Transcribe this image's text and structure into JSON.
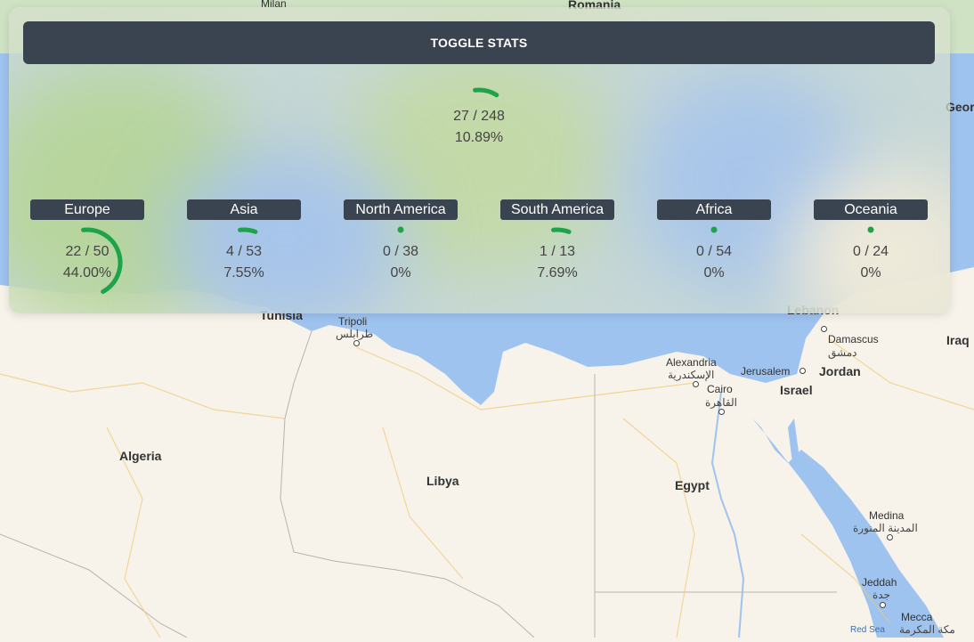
{
  "toggle_button": {
    "label": "TOGGLE STATS"
  },
  "total": {
    "count": "27 / 248",
    "percent": "10.89%",
    "fraction": 0.1089
  },
  "regions": [
    {
      "name": "Europe",
      "count": "22 / 50",
      "percent": "44.00%",
      "fraction": 0.44
    },
    {
      "name": "Asia",
      "count": "4 / 53",
      "percent": "7.55%",
      "fraction": 0.0755
    },
    {
      "name": "North America",
      "count": "0 / 38",
      "percent": "0%",
      "fraction": 0
    },
    {
      "name": "South America",
      "count": "1 / 13",
      "percent": "7.69%",
      "fraction": 0.0769
    },
    {
      "name": "Africa",
      "count": "0 / 54",
      "percent": "0%",
      "fraction": 0
    },
    {
      "name": "Oceania",
      "count": "0 / 24",
      "percent": "0%",
      "fraction": 0
    }
  ],
  "colors": {
    "gauge": "#1fa34a",
    "button": "#3a4350",
    "sea": "#9ec3ef",
    "land": "#f7f3ea"
  },
  "map": {
    "labels": {
      "romania": "Romania",
      "milan": "Milan",
      "georgia": "Geor",
      "tunisia": "Tunisia",
      "tripoli": "Tripoli",
      "tripoli_ar": "طرابلس",
      "algeria": "Algeria",
      "libya": "Libya",
      "egypt": "Egypt",
      "alexandria": "Alexandria",
      "alexandria_ar": "الإسكندرية",
      "cairo": "Cairo",
      "cairo_ar": "القاهرة",
      "jerusalem": "Jerusalem",
      "israel": "Israel",
      "jordan": "Jordan",
      "damascus": "Damascus",
      "damascus_ar": "دمشق",
      "iraq": "Iraq",
      "medina": "Medina",
      "medina_ar": "المدينة المنورة",
      "jeddah": "Jeddah",
      "jeddah_ar": "جدة",
      "mecca": "Mecca",
      "mecca_ar": "مكة المكرمة",
      "red_sea": "Red Sea",
      "lebanon": "Lebanon"
    }
  }
}
